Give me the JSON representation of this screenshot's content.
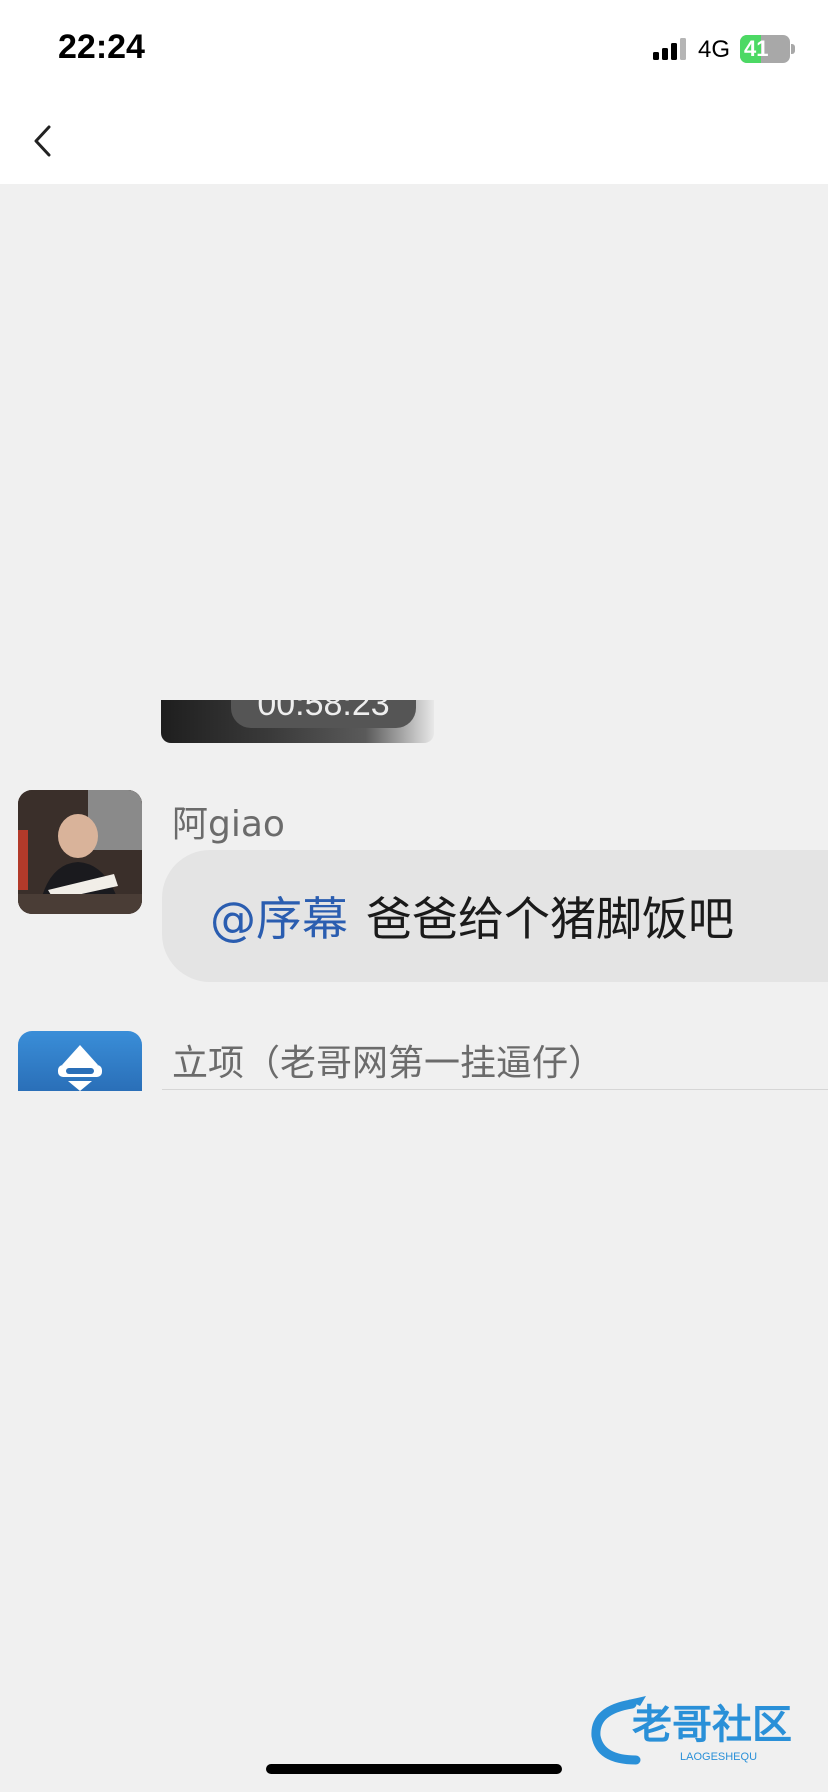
{
  "status_bar": {
    "time": "22:24",
    "network": "4G",
    "battery_level": "41",
    "battery_fraction": 0.41,
    "battery_color": "#4cd964"
  },
  "nav": {
    "back_icon": "chevron-left-icon"
  },
  "chat": {
    "video_message": {
      "duration": "00:58:23"
    },
    "messages": [
      {
        "sender": "阿giao",
        "mention": "@序幕",
        "text": "爸爸给个猪脚饭吧"
      },
      {
        "sender": "立项（老哥网第一挂逼仔）"
      }
    ],
    "mention_color": "#2a5db0"
  },
  "watermark": {
    "text": "老哥社区",
    "subtext": "LAOGESHEQU"
  }
}
